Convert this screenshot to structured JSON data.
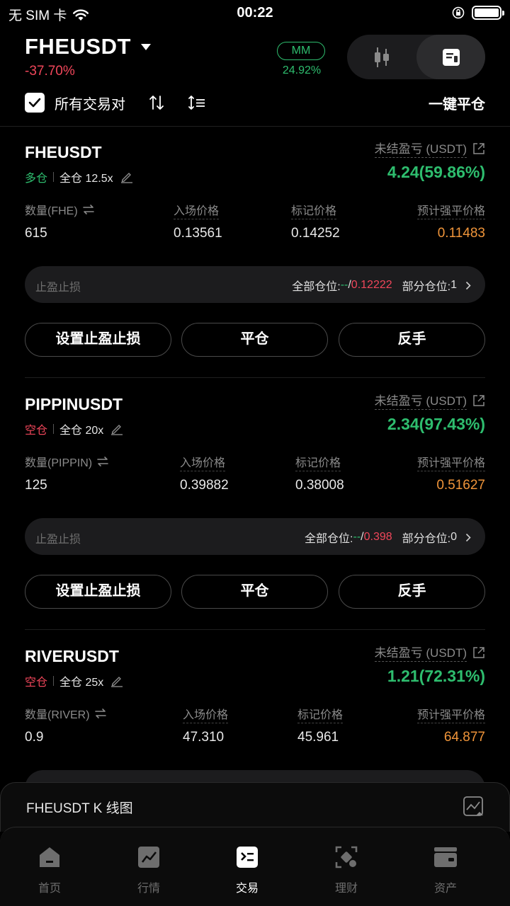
{
  "status_bar": {
    "carrier": "无 SIM 卡",
    "time": "00:22"
  },
  "header": {
    "pair": "FHEUSDT",
    "change": "-37.70%",
    "mm_label": "MM",
    "mm_value": "24.92%",
    "all_pairs_label": "所有交易对",
    "close_all_label": "一键平仓"
  },
  "labels": {
    "upnl": "未结盈亏 (USDT)",
    "entry_price": "入场价格",
    "mark_price": "标记价格",
    "liq_price": "预计强平价格",
    "tpsl": "止盈止损",
    "all_positions": "全部仓位: ",
    "partial_positions": "部分仓位: ",
    "set_tpsl_button": "设置止盈止损",
    "close_button": "平仓",
    "reverse_button": "反手"
  },
  "positions": [
    {
      "symbol": "FHEUSDT",
      "side": "多仓",
      "margin": "全仓 12.5x",
      "upnl": "4.24(59.86%)",
      "qty_label": "数量(FHE)",
      "qty": "615",
      "entry": "0.13561",
      "mark": "0.14252",
      "liq": "0.11483",
      "tp": "--",
      "sl": "0.12222",
      "partial_count": "1"
    },
    {
      "symbol": "PIPPINUSDT",
      "side": "空仓",
      "margin": "全仓 20x",
      "upnl": "2.34(97.43%)",
      "qty_label": "数量(PIPPIN)",
      "qty": "125",
      "entry": "0.39882",
      "mark": "0.38008",
      "liq": "0.51627",
      "tp": "--",
      "sl": "0.398",
      "partial_count": "0"
    },
    {
      "symbol": "RIVERUSDT",
      "side": "空仓",
      "margin": "全仓 25x",
      "upnl": "1.21(72.31%)",
      "qty_label": "数量(RIVER)",
      "qty": "0.9",
      "entry": "47.310",
      "mark": "45.961",
      "liq": "64.877"
    }
  ],
  "kline_bar": {
    "title": "FHEUSDT K 线图"
  },
  "tabbar": [
    {
      "label": "首页",
      "icon": "home-icon"
    },
    {
      "label": "行情",
      "icon": "chart-icon"
    },
    {
      "label": "交易",
      "icon": "trade-icon",
      "active": true
    },
    {
      "label": "理财",
      "icon": "finance-icon"
    },
    {
      "label": "资产",
      "icon": "wallet-icon"
    }
  ],
  "colors": {
    "green": "#2ebd6e",
    "red": "#f0465a",
    "orange": "#f0953a",
    "background": "#000000"
  }
}
